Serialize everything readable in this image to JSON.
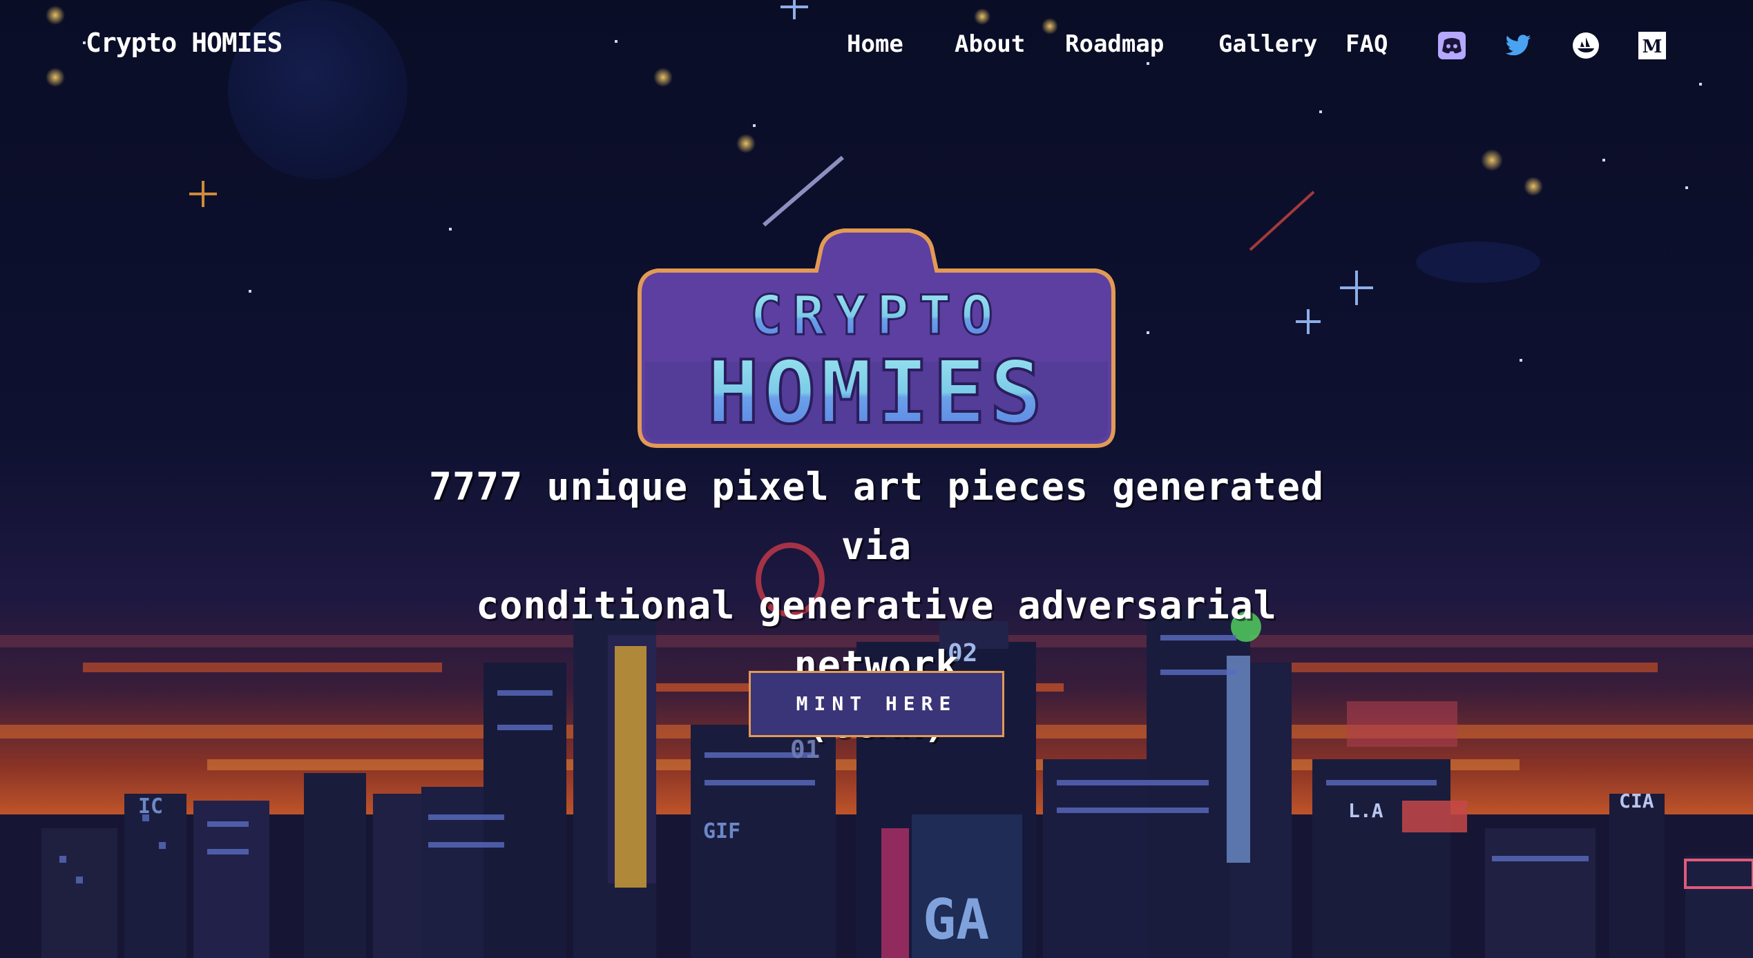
{
  "nav": {
    "brand": "Crypto HOMIES",
    "links": [
      {
        "label": "Home"
      },
      {
        "label": "About"
      },
      {
        "label": "Roadmap"
      },
      {
        "label": "Gallery"
      },
      {
        "label": "FAQ"
      }
    ],
    "social": [
      {
        "icon": "discord-icon",
        "color": "#b5a8ff"
      },
      {
        "icon": "twitter-icon",
        "color": "#4aa3f0"
      },
      {
        "icon": "opensea-icon",
        "color": "#ffffff"
      },
      {
        "icon": "medium-icon",
        "color": "#ffffff"
      }
    ]
  },
  "hero": {
    "logo_line1": "CRYPTO",
    "logo_line2": "HOMIES",
    "tagline": [
      "7777 unique pixel art pieces generated via",
      "conditional generative adversarial network",
      "(cGAN)"
    ],
    "cta_label": "MINT HERE"
  },
  "scene_signs": [
    "02",
    "01",
    "GIF",
    "IC",
    "L.A",
    "CIA",
    "GA"
  ],
  "colors": {
    "sky_top": "#0a0d26",
    "sky_mid": "#141538",
    "horizon": "#c2462a",
    "glow": "#e9884a",
    "accent_purple": "#5c3fa0",
    "accent_orange": "#e29a54",
    "logo_text_top": "#8ce0ee",
    "logo_text_bottom": "#5f86e6"
  }
}
